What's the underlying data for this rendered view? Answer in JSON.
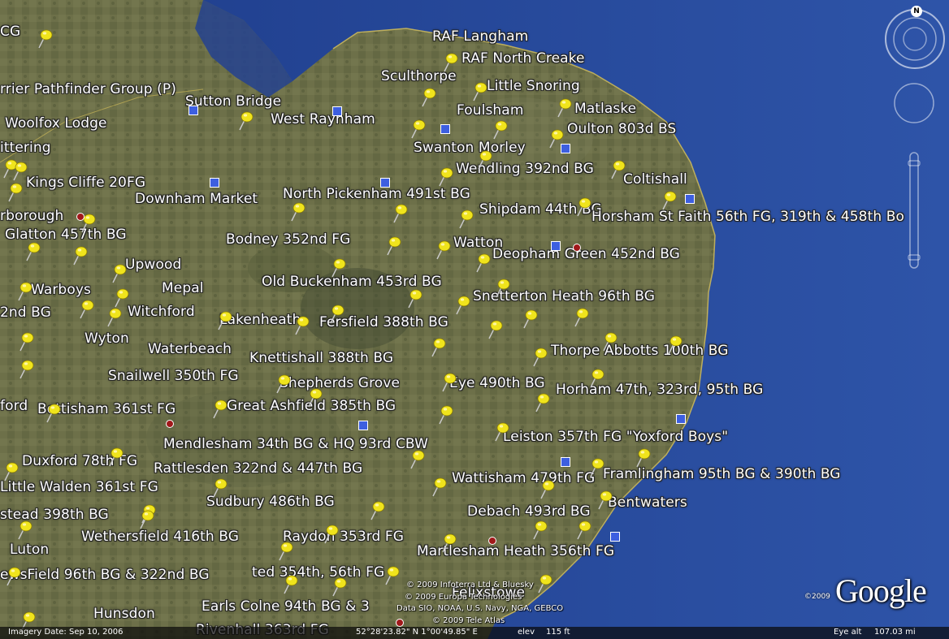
{
  "map": {
    "place_labels": [
      {
        "id": "cg",
        "text": "CG"
      },
      {
        "id": "pathfinder",
        "text": "rrier Pathfinder Group (P)"
      },
      {
        "id": "woolfox",
        "text": "Woolfox Lodge"
      },
      {
        "id": "kettering",
        "text": "ittering"
      },
      {
        "id": "kings-cliffe",
        "text": "Kings Cliffe 20FG"
      },
      {
        "id": "peterborough",
        "text": "rborough"
      },
      {
        "id": "glatton",
        "text": "Glatton 457th BG"
      },
      {
        "id": "upwood",
        "text": "Upwood"
      },
      {
        "id": "warboys",
        "text": "Warboys"
      },
      {
        "id": "mepal",
        "text": "Mepal"
      },
      {
        "id": "2nd-bg",
        "text": "2nd BG"
      },
      {
        "id": "witchford",
        "text": "Witchford"
      },
      {
        "id": "wyton",
        "text": "Wyton"
      },
      {
        "id": "lakenheath",
        "text": "Lakenheath"
      },
      {
        "id": "waterbeach",
        "text": "Waterbeach"
      },
      {
        "id": "snailwell",
        "text": "Snailwell 350th FG"
      },
      {
        "id": "ford",
        "text": "ford"
      },
      {
        "id": "bottisham",
        "text": "Bottisham 361st FG"
      },
      {
        "id": "duxford",
        "text": "Duxford 78th FG"
      },
      {
        "id": "little-walden",
        "text": "Little Walden 361st FG"
      },
      {
        "id": "stead",
        "text": "stead 398th BG"
      },
      {
        "id": "luton",
        "text": "Luton"
      },
      {
        "id": "wethersfield",
        "text": "Wethersfield 416th BG"
      },
      {
        "id": "ewsfield",
        "text": "ewsField 96th BG & 322nd BG"
      },
      {
        "id": "hunsdon",
        "text": "Hunsdon"
      },
      {
        "id": "sutton-bridge",
        "text": "Sutton Bridge"
      },
      {
        "id": "west-raynham",
        "text": "West Raynham"
      },
      {
        "id": "downham",
        "text": "Downham Market"
      },
      {
        "id": "north-pickenham",
        "text": "North Pickenham 491st BG"
      },
      {
        "id": "bodney",
        "text": "Bodney 352nd FG"
      },
      {
        "id": "old-buckenham",
        "text": "Old Buckenham 453rd BG"
      },
      {
        "id": "fersfield",
        "text": "Fersfield 388th BG"
      },
      {
        "id": "knettishall",
        "text": "Knettishall 388th BG"
      },
      {
        "id": "shepherds",
        "text": "Shepherds Grove"
      },
      {
        "id": "great-ashfield",
        "text": "Great Ashfield 385th BG"
      },
      {
        "id": "mendlesham",
        "text": "Mendlesham 34th BG & HQ 93rd CBW"
      },
      {
        "id": "rattlesden",
        "text": "Rattlesden 322nd & 447th BG"
      },
      {
        "id": "sudbury",
        "text": "Sudbury 486th BG"
      },
      {
        "id": "raydon",
        "text": "Raydon 353rd FG"
      },
      {
        "id": "boxted",
        "text": "ted 354th, 56th FG"
      },
      {
        "id": "earls-colne",
        "text": "Earls Colne 94th BG & 3"
      },
      {
        "id": "rivenhall",
        "text": "Rivenhall 363rd FG"
      },
      {
        "id": "raf-langham",
        "text": "RAF Langham"
      },
      {
        "id": "raf-north-creake",
        "text": "RAF North Creake"
      },
      {
        "id": "sculthorpe",
        "text": "Sculthorpe"
      },
      {
        "id": "little-snoring",
        "text": "Little Snoring"
      },
      {
        "id": "foulsham",
        "text": "Foulsham"
      },
      {
        "id": "matlaske",
        "text": "Matlaske"
      },
      {
        "id": "oulton",
        "text": "Oulton 803d BS"
      },
      {
        "id": "swanton",
        "text": "Swanton Morley"
      },
      {
        "id": "wendling",
        "text": "Wendling 392nd BG"
      },
      {
        "id": "coltishall",
        "text": "Coltishall"
      },
      {
        "id": "shipdam",
        "text": "Shipdam 44th BG"
      },
      {
        "id": "horsham",
        "text": "Horsham St Faith 56th FG, 319th & 458th Bo"
      },
      {
        "id": "watton",
        "text": "Watton"
      },
      {
        "id": "deopham",
        "text": "Deopham Green 452nd BG"
      },
      {
        "id": "snetterton",
        "text": "Snetterton Heath 96th BG"
      },
      {
        "id": "thorpe-abbotts",
        "text": "Thorpe Abbotts 100th BG"
      },
      {
        "id": "eye",
        "text": "Eye 490th BG"
      },
      {
        "id": "horham",
        "text": "Horham 47th, 323rd, 95th BG"
      },
      {
        "id": "leiston",
        "text": "Leiston 357th FG \"Yoxford Boys\""
      },
      {
        "id": "framlingham",
        "text": "Framlingham 95th BG & 390th BG"
      },
      {
        "id": "wattisham",
        "text": "Wattisham 479th FG"
      },
      {
        "id": "bentwaters",
        "text": "Bentwaters"
      },
      {
        "id": "debach",
        "text": "Debach 493rd BG"
      },
      {
        "id": "martlesham",
        "text": "Martlesham Heath 356th FG"
      },
      {
        "id": "felixstowe",
        "text": "Felixstowe"
      }
    ],
    "copyright_lines": [
      "© 2009 Infoterra Ltd & Bluesky",
      "© 2009 Europa Technologies",
      "Data SIO, NOAA, U.S. Navy, NGA, GEBCO",
      "© 2009 Tele Atlas"
    ],
    "logo_text": "Google",
    "logo_copyright": "©2009"
  },
  "status_bar": {
    "imagery_date": "Imagery Date: Sep 10, 2006",
    "coordinates": "52°28'23.82\" N   1°00'49.85\" E",
    "elev_label": "elev",
    "elev_value": "115 ft",
    "eye_alt_label": "Eye alt",
    "eye_alt_value": "107.03 mi"
  },
  "nav_controls": {
    "compass_north": "N"
  },
  "colors": {
    "sea": "#2a4a9a",
    "land": "#6b6e45",
    "label_text": "#ffffff",
    "pin": "#f0e41c",
    "marker_blue": "#3d5fe0",
    "marker_red": "#a0181a"
  }
}
